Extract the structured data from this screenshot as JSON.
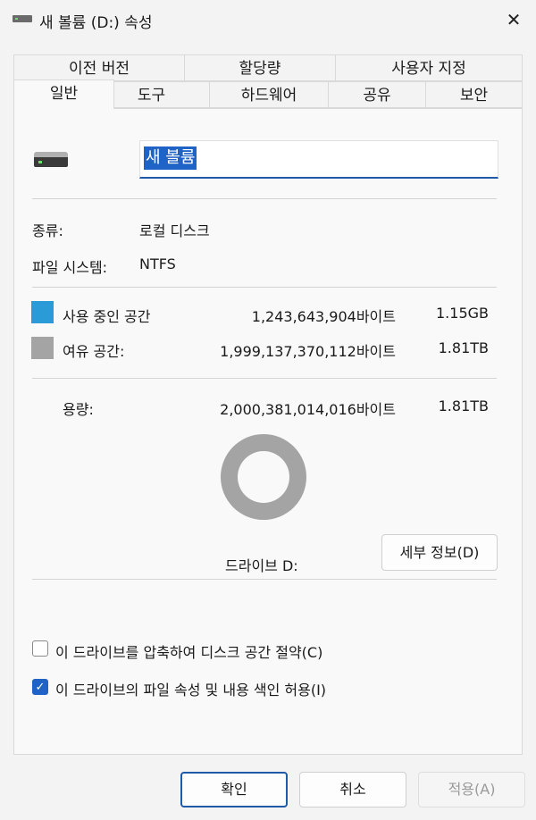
{
  "window": {
    "title": "새 볼륨 (D:) 속성",
    "close_label": "✕"
  },
  "tabs": {
    "row1": [
      "이전 버전",
      "할당량",
      "사용자 지정"
    ],
    "row2": [
      "일반",
      "도구",
      "하드웨어",
      "공유",
      "보안"
    ],
    "active": "일반"
  },
  "volume": {
    "name": "새 볼륨",
    "icon": "drive-icon"
  },
  "info": {
    "type_label": "종류:",
    "type_value": "로컬 디스크",
    "fs_label": "파일 시스템:",
    "fs_value": "NTFS"
  },
  "space": {
    "used_label": "사용 중인 공간",
    "used_bytes": "1,243,643,904바이트",
    "used_short": "1.15GB",
    "used_color": "#2b9bd8",
    "free_label": "여유 공간:",
    "free_bytes": "1,999,137,370,112바이트",
    "free_short": "1.81TB",
    "free_color": "#a4a4a4",
    "capacity_label": "용량:",
    "capacity_bytes": "2,000,381,014,016바이트",
    "capacity_short": "1.81TB"
  },
  "drive_label": "드라이브 D:",
  "details_button": "세부 정보(D)",
  "options": {
    "compress_label": "이 드라이브를 압축하여 디스크 공간 절약(C)",
    "compress_checked": false,
    "index_label": "이 드라이브의 파일 속성 및 내용 색인 허용(I)",
    "index_checked": true
  },
  "buttons": {
    "ok": "확인",
    "cancel": "취소",
    "apply": "적용(A)"
  }
}
